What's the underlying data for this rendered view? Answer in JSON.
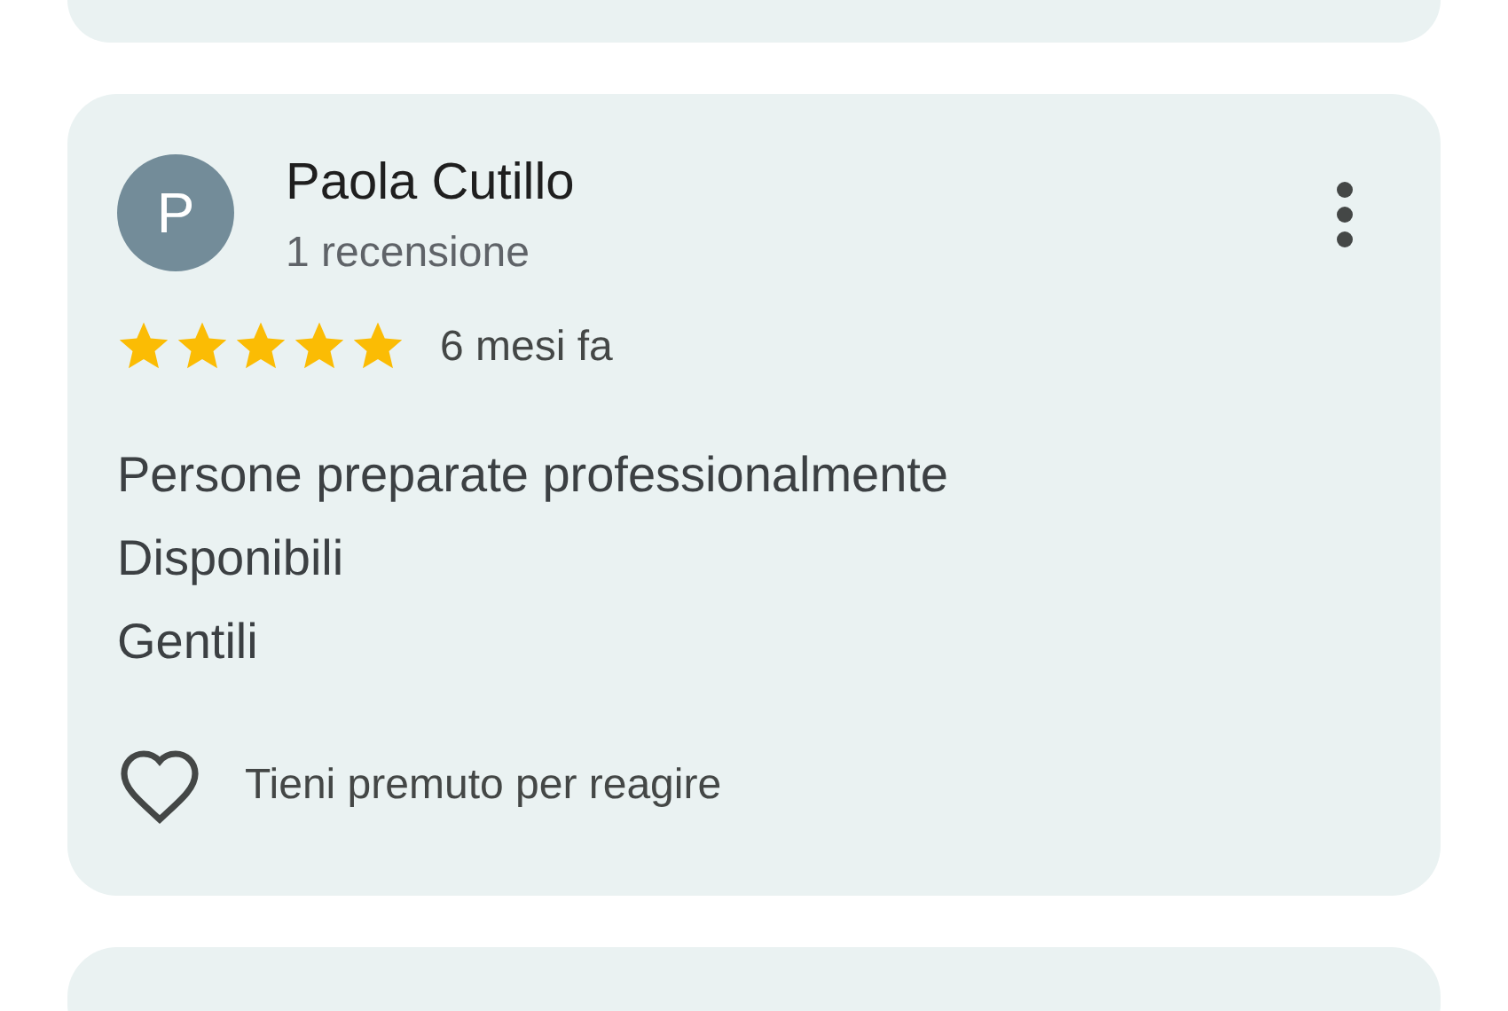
{
  "review": {
    "avatar_letter": "P",
    "author": "Paola Cutillo",
    "review_count": "1 recensione",
    "stars": 5,
    "time": "6 mesi fa",
    "lines": [
      "Persone preparate professionalmente",
      "Disponibili",
      "Gentili"
    ],
    "reaction_hint": "Tieni premuto per reagire"
  }
}
